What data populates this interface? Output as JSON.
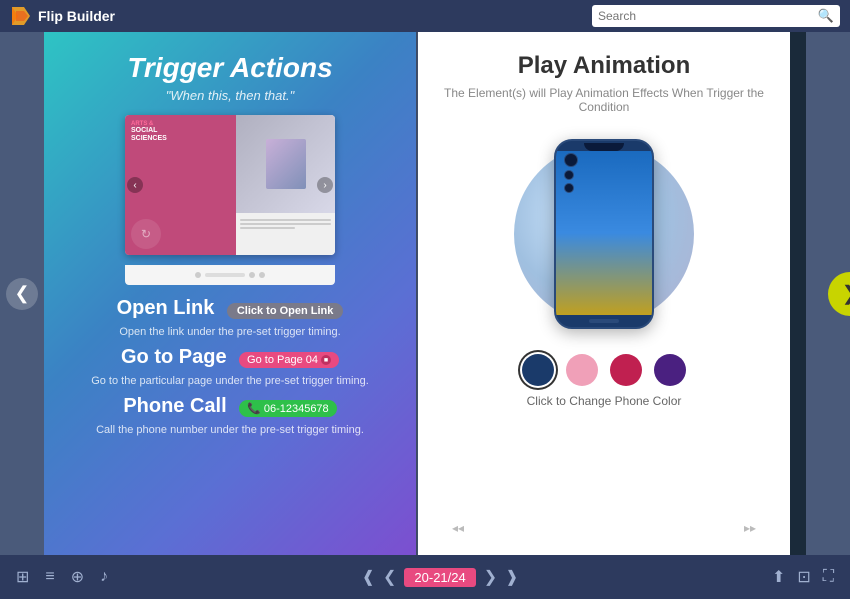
{
  "app": {
    "name": "Flip Builder",
    "logo_text": "Flip Builder"
  },
  "header": {
    "search_placeholder": "Search"
  },
  "left_page": {
    "title": "Trigger Actions",
    "subtitle": "\"When this, then that.\"",
    "actions": [
      {
        "title": "Open Link",
        "button_text": "Click to Open Link",
        "button_type": "gray",
        "description": "Open the link under the pre-set trigger timing."
      },
      {
        "title": "Go to Page",
        "button_text": "Go to Page 04",
        "button_type": "pink",
        "description": "Go to the particular page under the pre-set trigger timing."
      },
      {
        "title": "Phone Call",
        "button_text": "06-12345678",
        "button_type": "green",
        "description": "Call the phone number under the pre-set trigger timing."
      }
    ]
  },
  "right_page": {
    "title": "Play Animation",
    "subtitle": "The Element(s) will Play Animation Effects When Trigger the Condition",
    "colors": [
      {
        "name": "navy",
        "hex": "#1a3a6a",
        "selected": true
      },
      {
        "name": "pink",
        "hex": "#f0a0b8",
        "selected": false
      },
      {
        "name": "crimson",
        "hex": "#c02050",
        "selected": false
      },
      {
        "name": "purple",
        "hex": "#4a2080",
        "selected": false
      }
    ],
    "color_label": "Click to Change Phone Color"
  },
  "bottom_toolbar": {
    "page_indicator": "20-21/24",
    "icons": {
      "grid": "⊞",
      "list": "≡",
      "zoom": "⊕",
      "volume": "♪",
      "first": "⟨⟨",
      "prev": "⟨",
      "next": "⟩",
      "last": "⟩⟩",
      "share": "⬆",
      "fullscreen_enter": "⊡",
      "fullscreen_exit": "⛶"
    }
  }
}
